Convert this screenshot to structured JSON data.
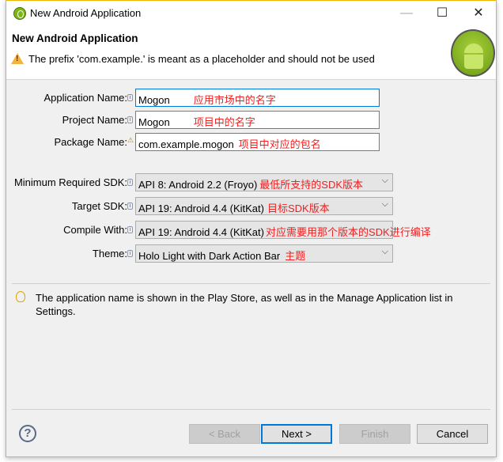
{
  "window": {
    "title": "New Android Application",
    "controls": {
      "minimize": "—",
      "maximize": "☐",
      "close": "✕"
    }
  },
  "header": {
    "title": "New Android Application",
    "message": "The prefix 'com.example.' is meant as a placeholder and should not be used"
  },
  "fields": [
    {
      "label": "Application Name:",
      "value": "Mogon",
      "note": "应用市场中的名字"
    },
    {
      "label": "Project Name:",
      "value": "Mogon",
      "note": "项目中的名字"
    },
    {
      "label": "Package Name:",
      "value": "com.example.mogon",
      "note": "项目中对应的包名"
    }
  ],
  "combos": [
    {
      "label": "Minimum Required SDK:",
      "value": "API 8: Android 2.2 (Froyo)",
      "note": "最低所支持的SDK版本"
    },
    {
      "label": "Target SDK:",
      "value": "API 19: Android 4.4 (KitKat)",
      "note": "目标SDK版本"
    },
    {
      "label": "Compile With:",
      "value": "API 19: Android 4.4 (KitKat)",
      "note": "对应需要用那个版本的SDK进行编译"
    },
    {
      "label": "Theme:",
      "value": "Holo Light with Dark Action Bar",
      "note": "主题"
    }
  ],
  "hint": "The application name is shown in the Play Store, as well as in the Manage Application list in Settings.",
  "buttons": {
    "back": "< Back",
    "next": "Next >",
    "finish": "Finish",
    "cancel": "Cancel",
    "help": "?"
  }
}
